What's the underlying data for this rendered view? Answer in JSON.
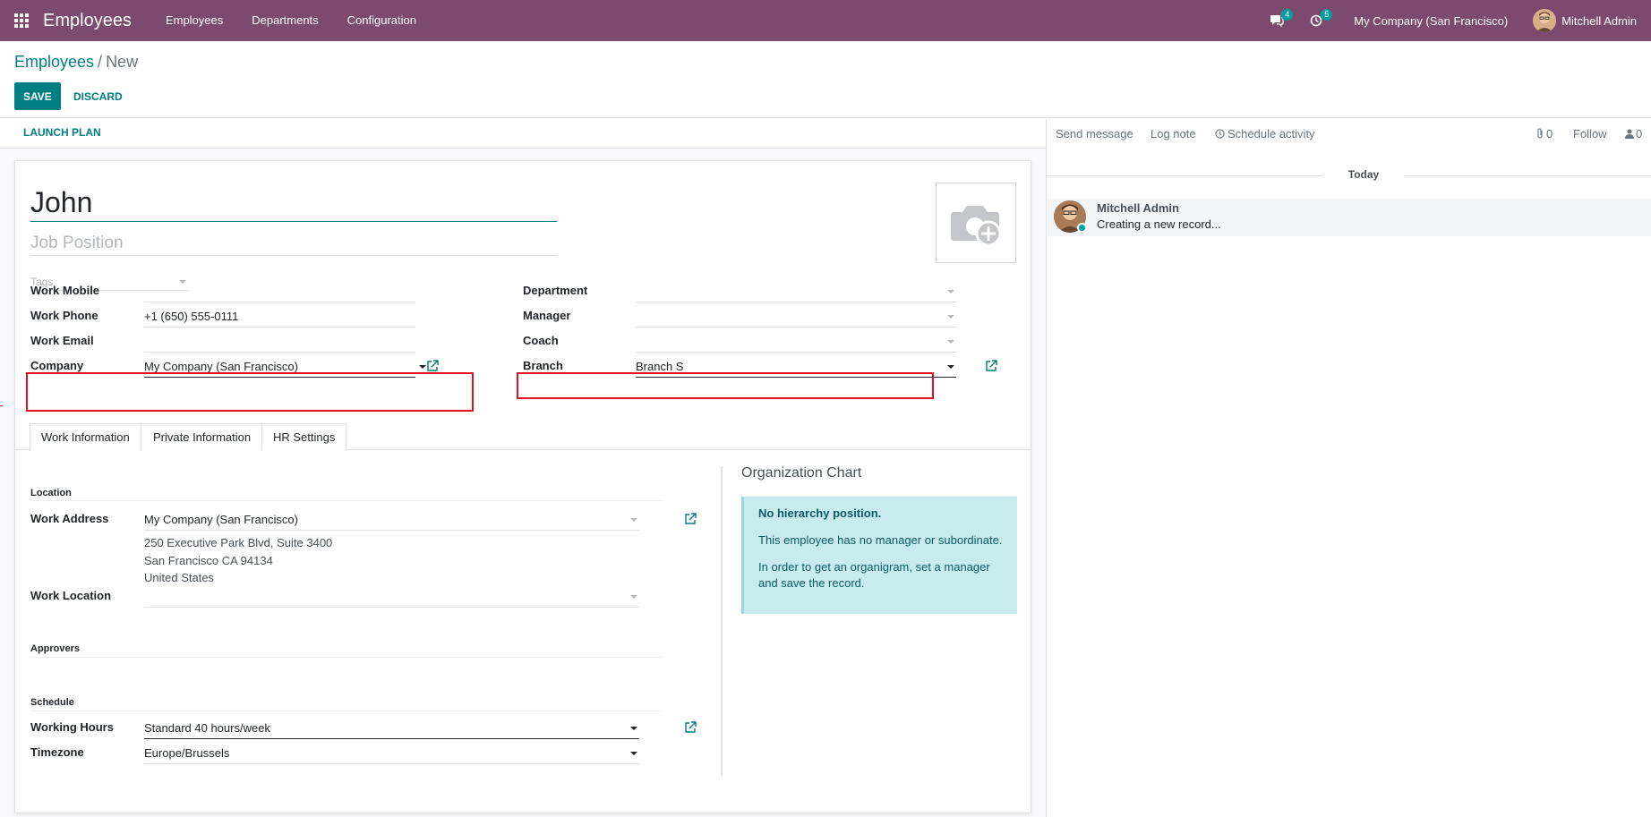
{
  "navbar": {
    "app_name": "Employees",
    "menu": [
      "Employees",
      "Departments",
      "Configuration"
    ],
    "messages_count": "4",
    "activities_count": "5",
    "company": "My Company (San Francisco)",
    "user": "Mitchell Admin",
    "color": "#7c4a6e"
  },
  "control_panel": {
    "breadcrumb_parent": "Employees",
    "breadcrumb_sep": "/",
    "breadcrumb_current": "New",
    "save_label": "SAVE",
    "discard_label": "DISCARD"
  },
  "statusbar": {
    "launch_plan_label": "LAUNCH PLAN"
  },
  "form": {
    "name": "John",
    "job_position_placeholder": "Job Position",
    "tags_placeholder": "Tags",
    "fields_left": [
      {
        "label": "Work Mobile",
        "value": ""
      },
      {
        "label": "Work Phone",
        "value": "+1 (650) 555-0111"
      },
      {
        "label": "Work Email",
        "value": ""
      },
      {
        "label": "Company",
        "value": "My Company (San Francisco)"
      }
    ],
    "fields_right": [
      {
        "label": "Department",
        "value": ""
      },
      {
        "label": "Manager",
        "value": ""
      },
      {
        "label": "Coach",
        "value": ""
      },
      {
        "label": "Branch",
        "value": "Branch S"
      }
    ],
    "tabs": [
      "Work Information",
      "Private Information",
      "HR Settings"
    ],
    "location": {
      "section": "Location",
      "work_address_label": "Work Address",
      "work_address_value": "My Company (San Francisco)",
      "address_lines": [
        "250 Executive Park Blvd, Suite 3400",
        "San Francisco CA 94134",
        "United States"
      ],
      "work_location_label": "Work Location",
      "work_location_value": ""
    },
    "approvers": {
      "section": "Approvers"
    },
    "schedule": {
      "section": "Schedule",
      "working_hours_label": "Working Hours",
      "working_hours_value": "Standard 40 hours/week",
      "timezone_label": "Timezone",
      "timezone_value": "Europe/Brussels"
    },
    "org_chart": {
      "title": "Organization Chart",
      "heading": "No hierarchy position.",
      "line1": "This employee has no manager or subordinate.",
      "line2": "In order to get an organigram, set a manager and save the record."
    }
  },
  "chatter": {
    "send_message": "Send message",
    "log_note": "Log note",
    "schedule_activity": "Schedule activity",
    "attachments_count": "0",
    "follow": "Follow",
    "followers_count": "0",
    "today": "Today",
    "message_author": "Mitchell Admin",
    "message_body": "Creating a new record..."
  },
  "colors": {
    "accent": "#017e84",
    "highlight": "#e4101d",
    "info_bg": "#c7ecef"
  }
}
